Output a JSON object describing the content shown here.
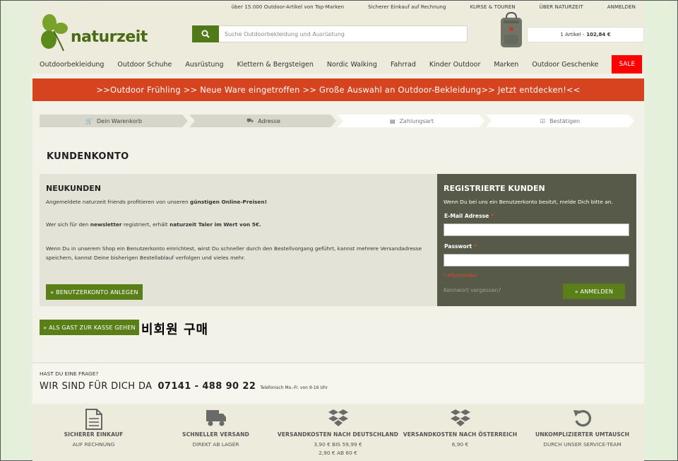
{
  "header": {
    "top_links": [
      "über 15.000 Outdoor-Artikel von Top-Marken",
      "Sicherer Einkauf auf Rechnung",
      "KURSE & TOUREN",
      "ÜBER NATURZEIT",
      "ANMELDEN"
    ],
    "logo_text": "naturzeit",
    "search_placeholder": "Suche Outdoorbekleidung und Ausrüstung",
    "cart_text": "1 Artikel - ",
    "cart_total": "102,84 €",
    "nav": [
      "Outdoorbekleidung",
      "Outdoor Schuhe",
      "Ausrüstung",
      "Klettern & Bergsteigen",
      "Nordic Walking",
      "Fahrrad",
      "Kinder Outdoor",
      "Marken",
      "Outdoor Geschenke"
    ],
    "nav_sale": "SALE"
  },
  "promo": ">>Outdoor Frühling >> Neue Ware eingetroffen >> Große Auswahl an Outdoor-Bekleidung>> Jetzt entdecken!<<",
  "steps": [
    "Dein Warenkorb",
    "Adresse",
    "Zahlungsart",
    "Bestätigen"
  ],
  "page_title": "KUNDENKONTO",
  "new_customers": {
    "title": "NEUKUNDEN",
    "p1_pre": "Angemeldete naturzeit friends profitieren von unseren ",
    "p1_bold": "günstigen Online-Preisen!",
    "p2_pre": "Wer sich für den ",
    "p2_bold1": "newsletter",
    "p2_mid": " registriert, erhält ",
    "p2_bold2": "naturzeit Taler im Wert von 5€.",
    "p3": "Wenn Du in unserem Shop ein Benutzerkonto einrichtest, wirst Du schneller durch den Bestellvorgang geführt, kannst mehrere Versandadresse speichern, kannst Deine bisherigen Bestellablauf verfolgen und vieles mehr.",
    "button": "» BENUTZERKONTO ANLEGEN"
  },
  "registered": {
    "title": "REGISTRIERTE KUNDEN",
    "desc": "Wenn Du bei uns ein Benutzerkonto besitzt, melde Dich bitte an.",
    "email_label": "E-Mail Adresse",
    "password_label": "Passwort",
    "required_mark": "*",
    "required_note": "* Pflichtfelder",
    "forgot": "Kennwort vergessen?",
    "login_button": "» ANMELDEN"
  },
  "guest_button": "» ALS GAST ZUR KASSE GEHEN",
  "korean_note": "비회원 구매",
  "contact": {
    "question": "HAST DU EINE FRAGE?",
    "headline": "WIR SIND FÜR DICH DA",
    "phone": "07141 - 488 90 22",
    "hours": "Telefonisch Mo.-Fr. von 9-16 Uhr"
  },
  "features": [
    {
      "icon": "document-icon",
      "t1": "SICHERER EINKAUF",
      "t2": "AUF RECHNUNG",
      "t3": ""
    },
    {
      "icon": "truck-icon",
      "t1": "SCHNELLER VERSAND",
      "t2": "DIREKT AB LAGER",
      "t3": ""
    },
    {
      "icon": "box-icon",
      "t1": "VERSANDKOSTEN NACH DEUTSCHLAND",
      "t2": "3,90 € BIS 59,99 €",
      "t3": "2,90 € AB 60 €"
    },
    {
      "icon": "box-icon",
      "t1": "VERSANDKOSTEN NACH ÖSTERREICH",
      "t2": "6,90 €",
      "t3": ""
    },
    {
      "icon": "return-icon",
      "t1": "UNKOMPLIZIERTER UMTAUSCH",
      "t2": "DURCH UNSER SERVICE-TEAM",
      "t3": ""
    }
  ],
  "colors": {
    "brand_green": "#5a7f18",
    "promo_red": "#d6431f",
    "sale_red": "#ff0000",
    "panel_dark": "#585a49"
  }
}
